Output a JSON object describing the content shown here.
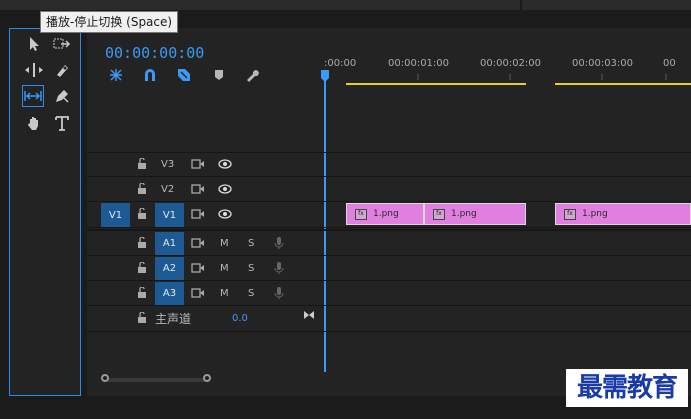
{
  "tooltip": "播放-停止切换 (Space)",
  "timecode": "00:00:00:00",
  "ruler": [
    ":00:00",
    "00:00:01:00",
    "00:00:02:00",
    "00:00:03:00",
    "00"
  ],
  "tracks": {
    "video": [
      {
        "id": "V3"
      },
      {
        "id": "V2"
      },
      {
        "id": "V1",
        "source": "V1"
      }
    ],
    "audio": [
      {
        "id": "A1",
        "m": "M",
        "s": "S"
      },
      {
        "id": "A2",
        "m": "M",
        "s": "S"
      },
      {
        "id": "A3",
        "m": "M",
        "s": "S"
      }
    ],
    "master": {
      "label": "主声道",
      "value": "0.0"
    }
  },
  "clips": [
    {
      "label": "1.png"
    },
    {
      "label": "1.png"
    },
    {
      "label": "1.png"
    }
  ],
  "watermark": "最需教育",
  "colors": {
    "accent": "#2d8ceb",
    "clip": "#e07fe0",
    "badge": "#1d5a93",
    "workarea": "#e6d21e"
  }
}
